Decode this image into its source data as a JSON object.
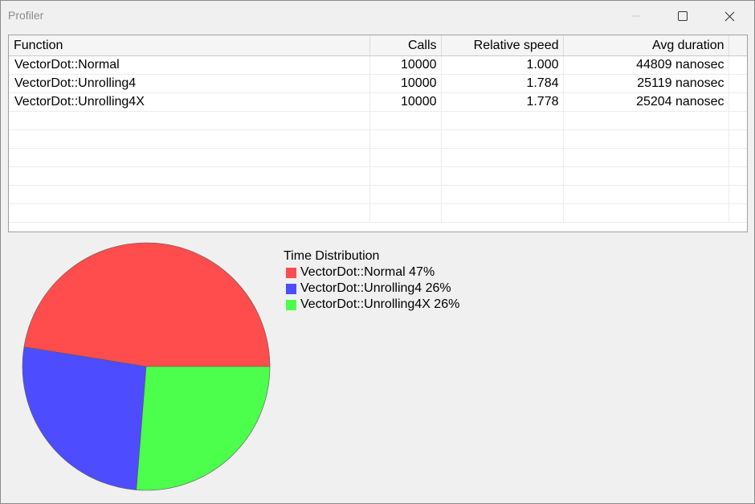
{
  "window": {
    "title": "Profiler",
    "controls": [
      "minimize-icon",
      "maximize-icon",
      "close-icon"
    ]
  },
  "table": {
    "columns": [
      "Function",
      "Calls",
      "Relative speed",
      "Avg duration"
    ],
    "rows": [
      [
        "VectorDot::Normal",
        "10000",
        "1.000",
        "44809 nanosec"
      ],
      [
        "VectorDot::Unrolling4",
        "10000",
        "1.784",
        "25119 nanosec"
      ],
      [
        "VectorDot::Unrolling4X",
        "10000",
        "1.778",
        "25204 nanosec"
      ]
    ]
  },
  "chart_data": {
    "type": "pie",
    "title": "Time Distribution",
    "slices": [
      {
        "label": "VectorDot::Normal 47%",
        "name": "VectorDot::Normal",
        "percent": 47,
        "color": "#ff4d4d"
      },
      {
        "label": "VectorDot::Unrolling4 26%",
        "name": "VectorDot::Unrolling4",
        "percent": 26,
        "color": "#4d4dff"
      },
      {
        "label": "VectorDot::Unrolling4X 26%",
        "name": "VectorDot::Unrolling4X",
        "percent": 26,
        "color": "#4dff4d"
      }
    ],
    "legend_placement": "right"
  }
}
